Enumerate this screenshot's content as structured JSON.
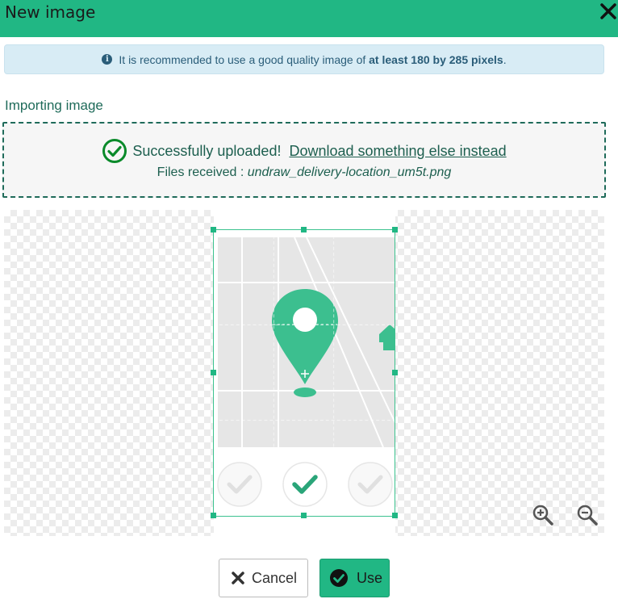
{
  "dialog": {
    "title": "New image",
    "close_icon": "close-icon"
  },
  "info": {
    "text_before": "It is recommended to use a good quality image of ",
    "text_bold": "at least 180 by 285 pixels",
    "text_after": "."
  },
  "import": {
    "section_label": "Importing image",
    "success_text": "Successfully uploaded!",
    "download_link": "Download something else instead",
    "files_received_label": "Files received :",
    "file_name": "undraw_delivery-location_um5t.png"
  },
  "cropper": {
    "zoom_in_icon": "zoom-in-icon",
    "zoom_out_icon": "zoom-out-icon"
  },
  "buttons": {
    "cancel_label": "Cancel",
    "use_label": "Use"
  },
  "colors": {
    "accent": "#21b784",
    "text_dark": "#1d5f4f",
    "info_bg": "#d8ecf5"
  }
}
